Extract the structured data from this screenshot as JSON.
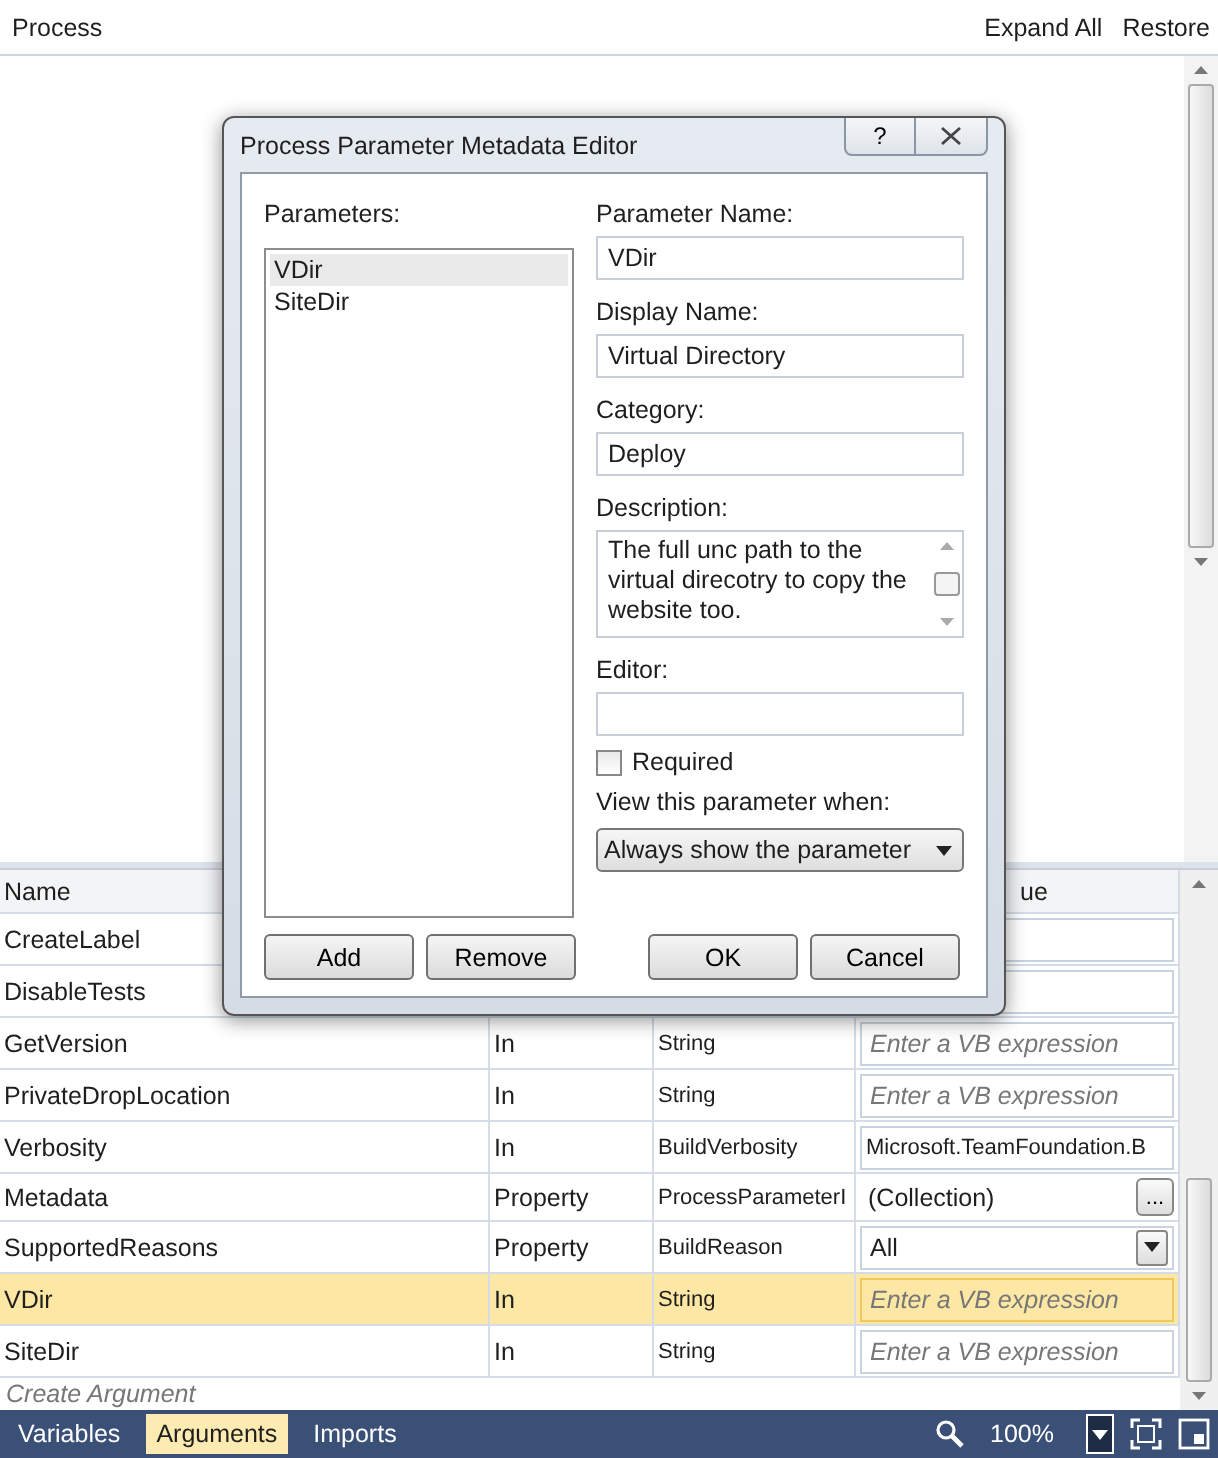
{
  "header": {
    "title": "Process",
    "actions": [
      "Expand All",
      "Restore"
    ]
  },
  "grid": {
    "columns": {
      "name": "Name",
      "column_4": "ue"
    },
    "rows": [
      {
        "name": "CreateLabel",
        "selected": false,
        "value": {
          "kind": "empty"
        }
      },
      {
        "name": "DisableTests",
        "selected": false,
        "value": {
          "kind": "empty"
        }
      },
      {
        "name": "GetVersion",
        "direction": "In",
        "type": "String",
        "selected": false,
        "value": {
          "kind": "placeholder",
          "text": "Enter a VB expression"
        }
      },
      {
        "name": "PrivateDropLocation",
        "direction": "In",
        "type": "String",
        "selected": false,
        "value": {
          "kind": "placeholder",
          "text": "Enter a VB expression"
        }
      },
      {
        "name": "Verbosity",
        "direction": "In",
        "type": "BuildVerbosity",
        "selected": false,
        "value": {
          "kind": "text",
          "text": "Microsoft.TeamFoundation.B"
        }
      },
      {
        "name": "Metadata",
        "direction": "Property",
        "type": "ProcessParameterI",
        "selected": false,
        "value": {
          "kind": "button",
          "text": "(Collection)",
          "button": "..."
        }
      },
      {
        "name": "SupportedReasons",
        "direction": "Property",
        "type": "BuildReason",
        "selected": false,
        "value": {
          "kind": "dropdown",
          "text": "All"
        }
      },
      {
        "name": "VDir",
        "direction": "In",
        "type": "String",
        "selected": true,
        "value": {
          "kind": "placeholder",
          "text": "Enter a VB expression"
        }
      },
      {
        "name": "SiteDir",
        "direction": "In",
        "type": "String",
        "selected": false,
        "value": {
          "kind": "placeholder",
          "text": "Enter a VB expression"
        }
      }
    ],
    "create": "Create Argument"
  },
  "bottom_bar": {
    "tabs": [
      {
        "label": "Variables",
        "selected": false
      },
      {
        "label": "Arguments",
        "selected": true
      },
      {
        "label": "Imports",
        "selected": false
      }
    ],
    "zoom": "100%"
  },
  "dialog": {
    "title": "Process Parameter Metadata Editor",
    "help": "?",
    "parameters_label": "Parameters:",
    "parameters": [
      {
        "label": "VDir",
        "selected": true
      },
      {
        "label": "SiteDir",
        "selected": false
      }
    ],
    "fields": [
      {
        "label": "Parameter Name:",
        "value": "VDir"
      },
      {
        "label": "Display Name:",
        "value": "Virtual Directory"
      },
      {
        "label": "Category:",
        "value": "Deploy"
      }
    ],
    "description_label": "Description:",
    "description": "The full unc path to the virtual direcotry to copy the website too.",
    "editor_label": "Editor:",
    "required": {
      "label": "Required",
      "checked": false
    },
    "view_label": "View this parameter when:",
    "view_value": "Always show the parameter",
    "buttons": [
      "Add",
      "Remove",
      "OK",
      "Cancel"
    ]
  }
}
